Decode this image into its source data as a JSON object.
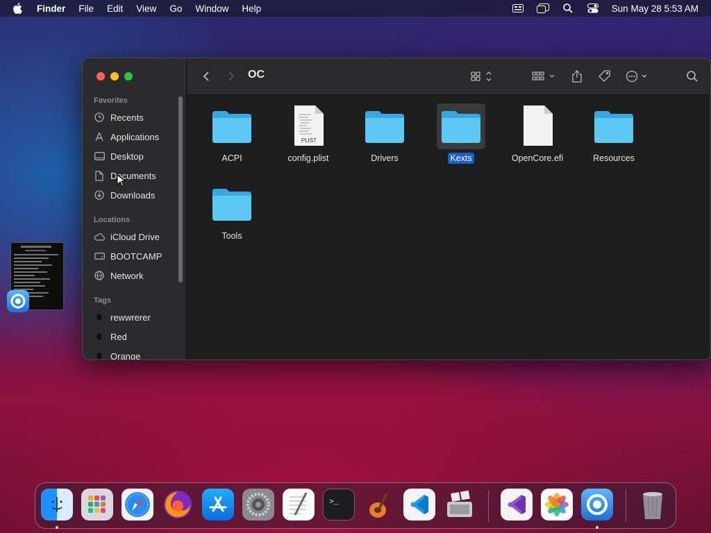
{
  "menubar": {
    "app_name": "Finder",
    "menus": [
      "File",
      "Edit",
      "View",
      "Go",
      "Window",
      "Help"
    ],
    "clock": "Sun May 28  5:53 AM"
  },
  "window": {
    "title": "OC",
    "sidebar": {
      "favorites_header": "Favorites",
      "favorites": [
        {
          "label": "Recents",
          "icon": "clock-icon"
        },
        {
          "label": "Applications",
          "icon": "applications-icon"
        },
        {
          "label": "Desktop",
          "icon": "desktop-icon"
        },
        {
          "label": "Documents",
          "icon": "document-icon"
        },
        {
          "label": "Downloads",
          "icon": "download-icon"
        }
      ],
      "locations_header": "Locations",
      "locations": [
        {
          "label": "iCloud Drive",
          "icon": "cloud-icon"
        },
        {
          "label": "BOOTCAMP",
          "icon": "drive-icon"
        },
        {
          "label": "Network",
          "icon": "globe-icon"
        }
      ],
      "tags_header": "Tags",
      "tags": [
        {
          "label": "rewwrerer",
          "color": "#111111"
        },
        {
          "label": "Red",
          "color": "#111111"
        },
        {
          "label": "Orange",
          "color": "#111111"
        }
      ]
    },
    "files": [
      {
        "name": "ACPI",
        "type": "folder",
        "selected": false
      },
      {
        "name": "config.plist",
        "type": "plist",
        "selected": false,
        "badge": "PLIST"
      },
      {
        "name": "Drivers",
        "type": "folder",
        "selected": false
      },
      {
        "name": "Kexts",
        "type": "folder",
        "selected": true
      },
      {
        "name": "OpenCore.efi",
        "type": "file",
        "selected": false
      },
      {
        "name": "Resources",
        "type": "folder",
        "selected": false
      },
      {
        "name": "Tools",
        "type": "folder",
        "selected": false
      }
    ]
  },
  "dock": {
    "apps": [
      "Finder",
      "Launchpad",
      "Safari",
      "Firefox",
      "App Store",
      "System Preferences",
      "TextEdit",
      "Terminal",
      "GarageBand",
      "Visual Studio Code",
      "Boot Camp Assistant",
      "Visual Studio",
      "Photos",
      "OpenCore Configurator",
      "Trash"
    ]
  },
  "colors": {
    "selection": "#1a5fd0",
    "folder": "#4fc3f7"
  }
}
